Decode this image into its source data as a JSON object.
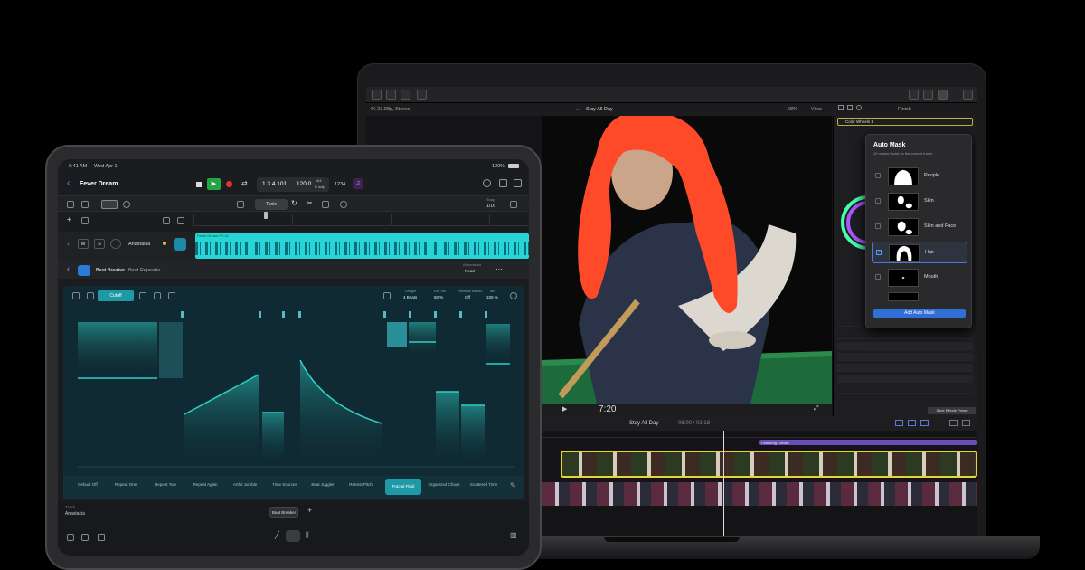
{
  "macbook": {
    "info_left": "4K 23.98p, Stereo",
    "project_title": "Stay All Day",
    "zoom": "68%",
    "view_label": "View",
    "inspector_tab": "Finish",
    "effect_name": "Color Wheels 1",
    "automask": {
      "title": "Auto Mask",
      "subtitle": "10 masks found on the current frame.",
      "items": [
        {
          "label": "People",
          "checked": false
        },
        {
          "label": "Skin",
          "checked": false
        },
        {
          "label": "Skin and Face",
          "checked": false
        },
        {
          "label": "Hair",
          "checked": true
        },
        {
          "label": "Mouth",
          "checked": false
        }
      ],
      "add_button": "Add Auto Mask"
    },
    "save_preset": "Save Effects Preset",
    "timecode": "7:20",
    "timeline_title": "Stay All Day",
    "timeline_duration": "06:00 / 02:18",
    "clip_title": "Featuring Credits",
    "colors": {
      "accent": "#2f6fd6",
      "hair": "#ff4a2a",
      "clip": "#e8d33a"
    }
  },
  "ipad": {
    "status": {
      "time": "9:41 AM",
      "date": "Wed Apr 1",
      "battery": "100%"
    },
    "song": "Fever Dream",
    "lcd": {
      "position": "1 3 4 101",
      "tempo": "120.0",
      "signature": "4/4",
      "key": "C maj",
      "count": "1234"
    },
    "snap_label": "Snap",
    "snap_value": "1/16",
    "tool_label": "Tools",
    "track": {
      "name": "Anastacia",
      "mute": "M",
      "solo": "S",
      "region": "Fever Dream FX #1"
    },
    "plugin": {
      "name": "Beat Breaker",
      "preset": "Beat Repeater",
      "automation_label": "Automation",
      "automation_value": "Read",
      "mode": "Cutoff",
      "params": [
        {
          "label": "Length",
          "value": "4 Beats"
        },
        {
          "label": "Dry Vol",
          "value": "50 %"
        },
        {
          "label": "Reverse Behav",
          "value": "Off"
        },
        {
          "label": "Mix",
          "value": "100 %"
        }
      ]
    },
    "presets": [
      "Default Off",
      "Repeat One",
      "Repeat Two",
      "Repeat Again",
      "Artful Jumble",
      "Time Sources",
      "Beat Juggler",
      "Retrest Pitch",
      "Fractal Fluid",
      "Organized Chaos",
      "Scattered Time"
    ],
    "active_preset": "Fractal Fluid",
    "footer": {
      "track_label": "Track",
      "track_name": "Anastacia",
      "bypass_button": "Beat Breaker"
    }
  }
}
